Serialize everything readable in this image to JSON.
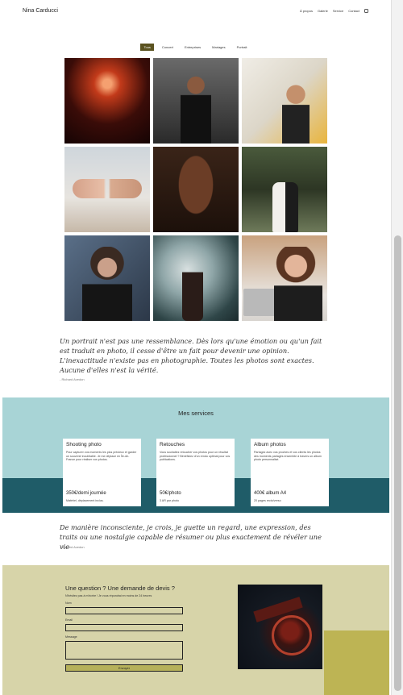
{
  "header": {
    "brand": "Nina Carducci",
    "nav": [
      "À propos",
      "Galerie",
      "Service",
      "Contact"
    ],
    "instagram_icon": "instagram-icon"
  },
  "filters": [
    "Tous",
    "Concert",
    "Entreprises",
    "Mariages",
    "Portrait"
  ],
  "active_filter": "Tous",
  "gallery": {
    "images": [
      "concert",
      "business-man",
      "business-woman",
      "hands-wedding",
      "portrait-man",
      "wedding-couple",
      "portrait-woman",
      "concert-crowd",
      "laughing-woman"
    ]
  },
  "quote1": {
    "text": "Un portrait n'est pas une ressemblance. Dès lors qu'une émotion ou qu'un fait est traduit en photo, il cesse d'être un fait pour devenir une opinion. L'inexactitude n'existe pas en photographie. Toutes les photos sont exactes. Aucune d'elles n'est la vérité.",
    "author": "- Richard Avedon"
  },
  "services": {
    "title": "Mes services",
    "cards": [
      {
        "title": "Shooting photo",
        "desc": "Pour capturer vos moments les plus précieux et garder un souvenir inoubliable. Je me déplace en Île-de-France pour réaliser vos photos.",
        "price": "350€/demi journée",
        "sub": "Matériel, déplacement inclus."
      },
      {
        "title": "Retouches",
        "desc": "Vous souhaitez retoucher vos photos pour un résultat professionnel ? Bénéficiez d'un rendu optimal pour vos publications.",
        "price": "50€/photo",
        "sub": "3 AR par photo"
      },
      {
        "title": "Album photos",
        "desc": "Partagez avec vos proches et vos clients les photos des moments partagés ensemble à travers un album photo personnalisé.",
        "price": "400€ album A4",
        "sub": "20 pages recto/verso"
      }
    ]
  },
  "quote2": {
    "text": "De manière inconsciente, je crois, je guette un regard, une expression, des traits ou une nostalgie capable de résumer ou plus exactement de révéler une vie",
    "author": "- Richard Avedon"
  },
  "contact": {
    "title": "Une question ? Une demande de devis ?",
    "subtitle": "N'hésitez pas à m'écrire ! Je vous répondrai en moins de 24 heures",
    "name_label": "Nom",
    "email_label": "Email",
    "message_label": "Message",
    "send_label": "Envoyer"
  },
  "colors": {
    "accent": "#5b5320",
    "services_light": "#a8d4d6",
    "services_dark": "#1f5c68",
    "contact_bg": "#d7d4a9",
    "olive": "#bdb454"
  }
}
